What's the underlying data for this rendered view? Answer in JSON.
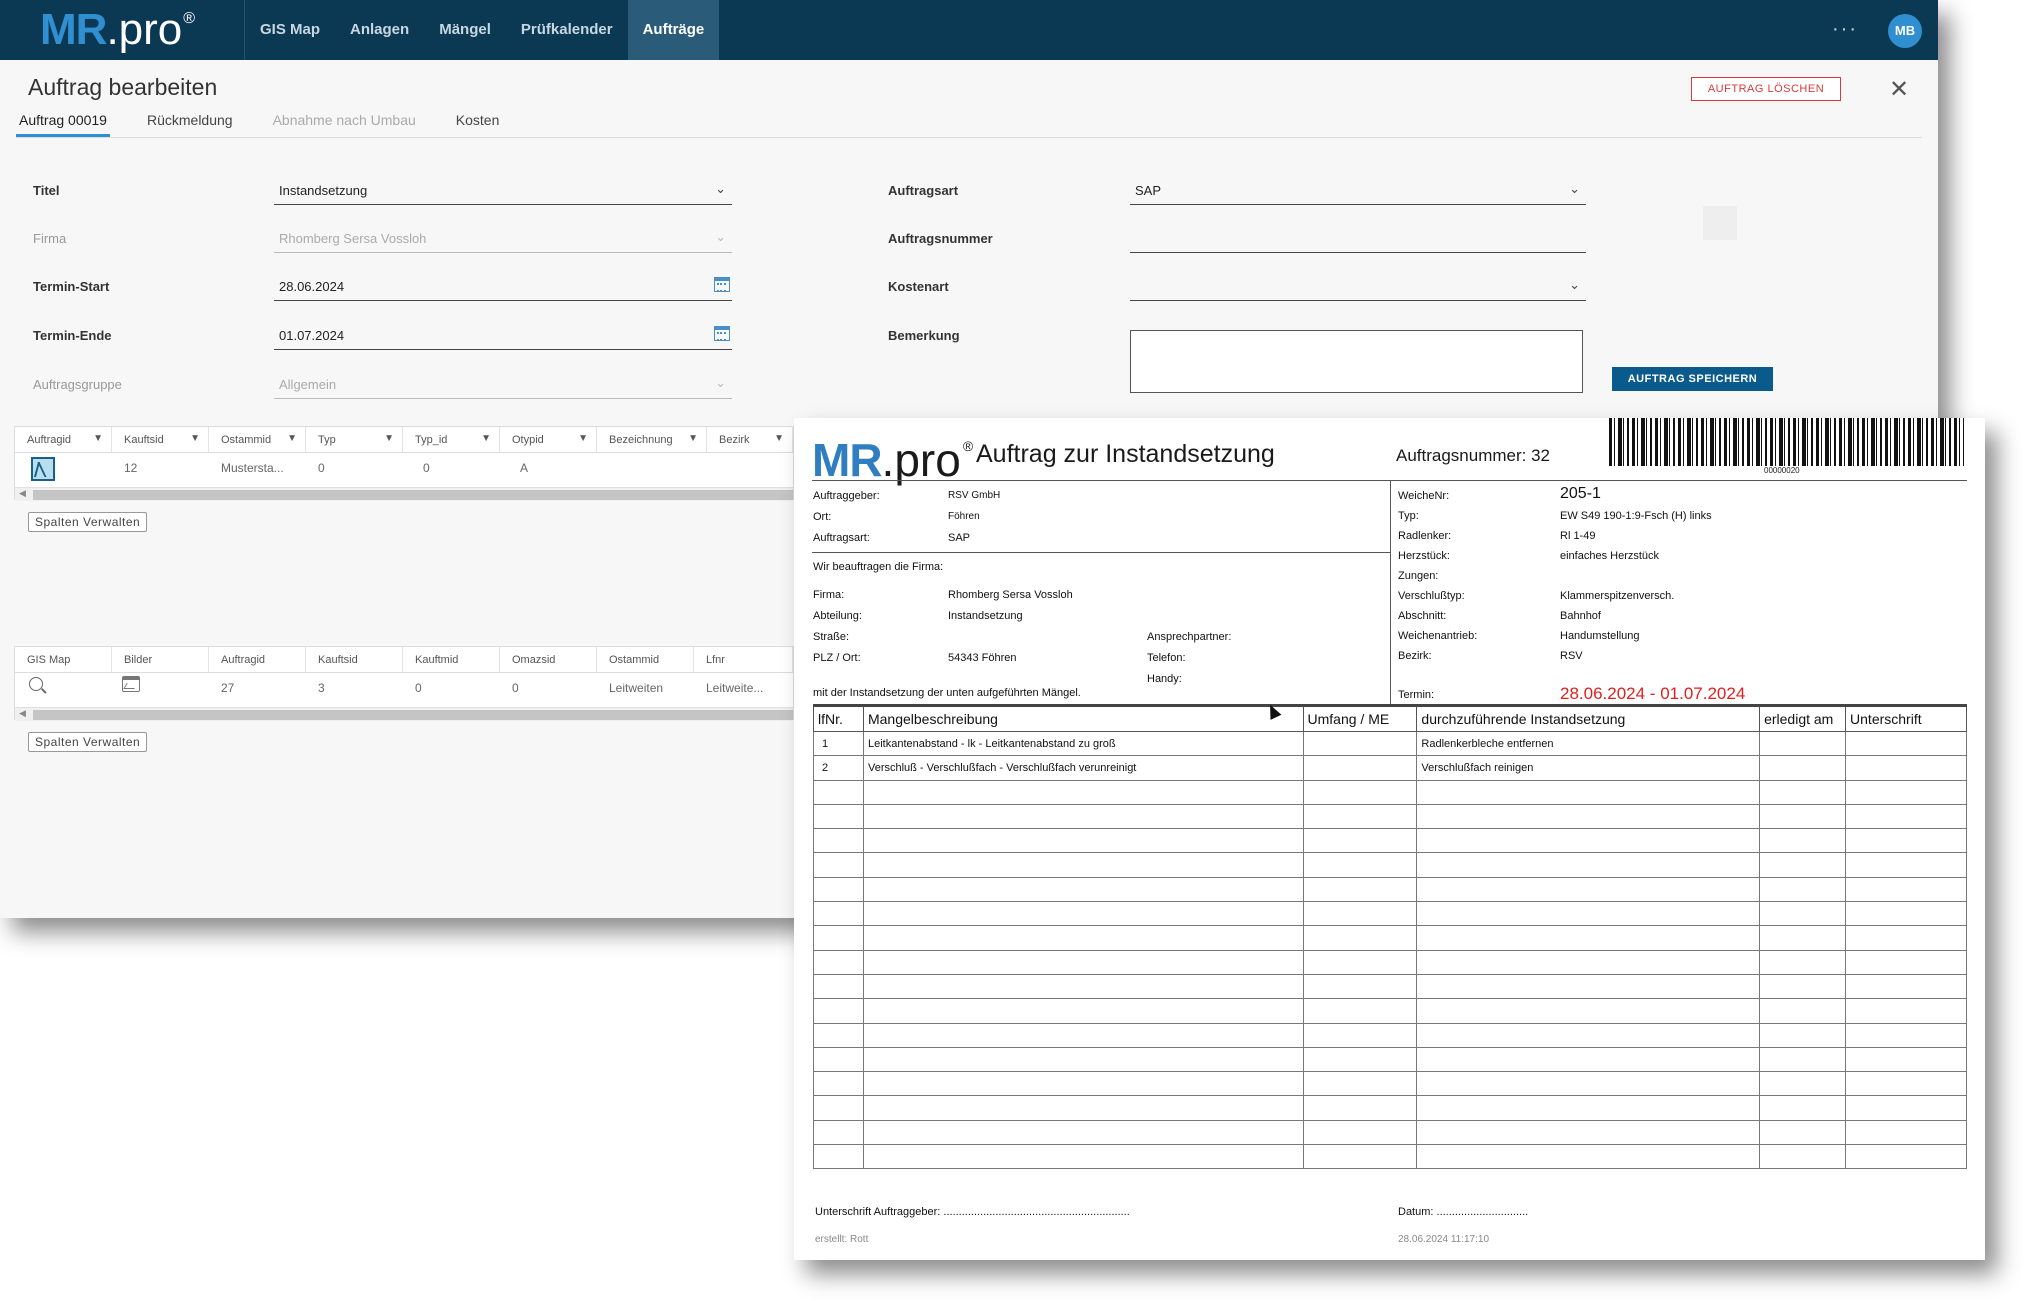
{
  "app": {
    "logo": {
      "mr": "MR",
      "pro": ".pro",
      "reg": "®"
    },
    "nav": [
      "GIS Map",
      "Anlagen",
      "Mängel",
      "Prüfkalender",
      "Aufträge"
    ],
    "nav_active": "Aufträge",
    "more": "···",
    "avatar": "MB"
  },
  "dialog": {
    "title": "Auftrag bearbeiten",
    "delete_label": "AUFTRAG LÖSCHEN",
    "close": "✕",
    "tabs": [
      "Auftrag 00019",
      "Rückmeldung",
      "Abnahme nach Umbau",
      "Kosten"
    ],
    "form": {
      "titel_label": "Titel",
      "titel_value": "Instandsetzung",
      "firma_label": "Firma",
      "firma_value": "Rhomberg Sersa Vossloh",
      "start_label": "Termin-Start",
      "start_value": "28.06.2024",
      "ende_label": "Termin-Ende",
      "ende_value": "01.07.2024",
      "gruppe_label": "Auftragsgruppe",
      "gruppe_value": "Allgemein",
      "art_label": "Auftragsart",
      "art_value": "SAP",
      "nummer_label": "Auftragsnummer",
      "nummer_value": "",
      "kosten_label": "Kostenart",
      "kosten_value": "",
      "bemerkung_label": "Bemerkung",
      "save_label": "AUFTRAG SPEICHERN"
    }
  },
  "grid1": {
    "columns": [
      "Auftragid",
      "Kauftsid",
      "Ostammid",
      "Typ",
      "Typ_id",
      "Otypid",
      "Bezeichnung",
      "Bezirk"
    ],
    "row": [
      "",
      "12",
      "Mustersta...",
      "0",
      "0",
      "A",
      "",
      ""
    ],
    "manage_label": "Spalten Verwalten"
  },
  "grid2": {
    "columns": [
      "GIS Map",
      "Bilder",
      "Auftragid",
      "Kauftsid",
      "Kauftmid",
      "Omazsid",
      "Ostammid",
      "Lfnr"
    ],
    "row": [
      "",
      "",
      "27",
      "3",
      "0",
      "0",
      "Leitweiten",
      "Leitweite..."
    ],
    "manage_label": "Spalten Verwalten"
  },
  "doc": {
    "logo": {
      "mr": "MR",
      "pro": ".pro",
      "reg": "®"
    },
    "title": "Auftrag zur Instandsetzung",
    "ordno": "Auftragsnummer: 32",
    "barcode_num": "00000020",
    "left": {
      "auftraggeber_l": "Auftraggeber:",
      "auftraggeber_v": "RSV GmbH",
      "ort_l": "Ort:",
      "ort_v": "Föhren",
      "auftragsart_l": "Auftragsart:",
      "auftragsart_v": "SAP",
      "beauftragen": "Wir beauftragen die Firma:",
      "firma_l": "Firma:",
      "firma_v": "Rhomberg Sersa Vossloh",
      "abteilung_l": "Abteilung:",
      "abteilung_v": "Instandsetzung",
      "strasse_l": "Straße:",
      "plz_l": "PLZ / Ort:",
      "plz_v": "54343 Föhren",
      "ansprech_l": "Ansprechpartner:",
      "telefon_l": "Telefon:",
      "handy_l": "Handy:",
      "mit": "mit der Instandsetzung der unten aufgeführten Mängel."
    },
    "right": {
      "weiche_l": "WeicheNr:",
      "weiche_v": "205-1",
      "typ_l": "Typ:",
      "typ_v": "EW S49 190-1:9-Fsch (H) links",
      "radlenker_l": "Radlenker:",
      "radlenker_v": "Rl 1-49",
      "herz_l": "Herzstück:",
      "herz_v": "einfaches Herzstück",
      "zungen_l": "Zungen:",
      "versch_l": "Verschlußtyp:",
      "versch_v": "Klammerspitzenversch.",
      "abschnitt_l": "Abschnitt:",
      "abschnitt_v": "Bahnhof",
      "antrieb_l": "Weichenantrieb:",
      "antrieb_v": "Handumstellung",
      "bezirk_l": "Bezirk:",
      "bezirk_v": "RSV",
      "termin_l": "Termin:",
      "termin_v": "28.06.2024  - 01.07.2024"
    },
    "table": {
      "headers": [
        "lfNr.",
        "Mangelbeschreibung",
        "Umfang / ME",
        "durchzuführende Instandsetzung",
        "erledigt am",
        "Unterschrift"
      ],
      "rows": [
        [
          "1",
          "Leitkantenabstand - lk - Leitkantenabstand zu groß",
          "",
          "Radlenkerbleche entfernen",
          "",
          ""
        ],
        [
          "2",
          "Verschluß - Verschlußfach - Verschlußfach verunreinigt",
          "",
          "Verschlußfach reinigen",
          "",
          ""
        ]
      ],
      "empty_rows": 16
    },
    "footer": {
      "sign_l": "Unterschrift Auftraggeber: .............................................................",
      "datum_l": "Datum: ..............................",
      "erstellt": "erstellt: Rott",
      "stamp": "28.06.2024 11:17:10"
    }
  }
}
